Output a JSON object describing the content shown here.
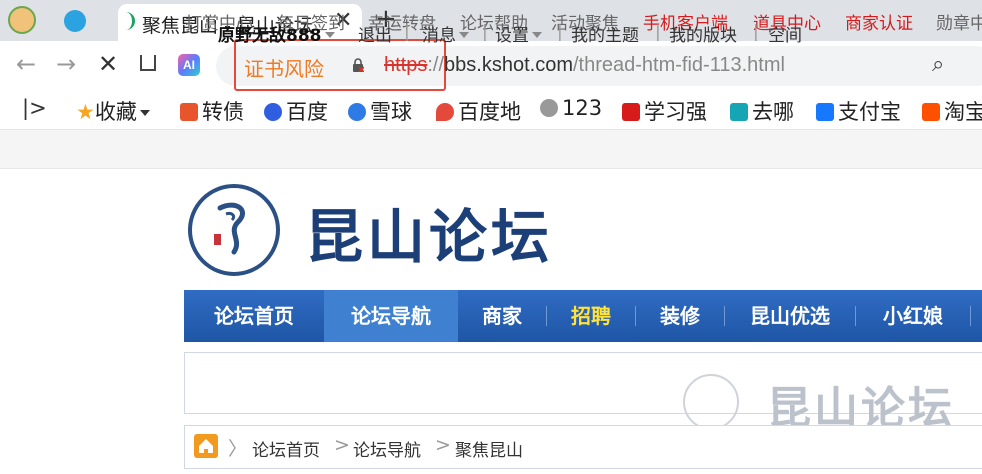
{
  "browser": {
    "tab_title": "聚焦昆山 - 昆山论坛",
    "tab_close": "✕",
    "new_tab": "+",
    "cert_warning": "证书风险",
    "url_scheme": "https",
    "url_sep": "://",
    "url_host": "bbs.kshot.com",
    "url_path": "/thread-htm-fid-113.html",
    "ai_label": "AI",
    "bookmarks": [
      {
        "label": "收藏",
        "icon": "star-icon",
        "color": "#f5a623"
      },
      {
        "label": "转债",
        "icon": "zhuanzhai-icon",
        "color": "#e8552c"
      },
      {
        "label": "百度",
        "icon": "baidu-paw-icon",
        "color": "#2f5fe0"
      },
      {
        "label": "雪球",
        "icon": "xueqiu-icon",
        "color": "#2f7be5"
      },
      {
        "label": "百度地",
        "icon": "map-pin-icon",
        "color": "#e34a3c"
      },
      {
        "label": "123",
        "icon": "globe-icon",
        "color": "#777777"
      },
      {
        "label": "学习强",
        "icon": "xuexi-icon",
        "color": "#d71b1b"
      },
      {
        "label": "去哪",
        "icon": "qunar-icon",
        "color": "#16a5b5"
      },
      {
        "label": "支付宝",
        "icon": "alipay-icon",
        "color": "#1677ff"
      },
      {
        "label": "淘宝",
        "icon": "taobao-icon",
        "color": "#ff5000"
      }
    ]
  },
  "site": {
    "top_links": [
      {
        "label": "打赏中心",
        "red": false
      },
      {
        "label": "每日签到",
        "red": false
      },
      {
        "label": "幸运转盘",
        "red": false
      },
      {
        "label": "论坛帮助",
        "red": false
      },
      {
        "label": "活动聚焦",
        "red": false
      },
      {
        "label": "手机客户端",
        "red": true
      },
      {
        "label": "道具中心",
        "red": true
      },
      {
        "label": "商家认证",
        "red": true
      },
      {
        "label": "勋章中",
        "red": false
      }
    ],
    "logo_text": "昆山论坛",
    "nav": [
      {
        "label": "论坛首页",
        "active": false,
        "yellow": false
      },
      {
        "label": "论坛导航",
        "active": true,
        "yellow": false
      },
      {
        "label": "商家",
        "active": false,
        "yellow": false
      },
      {
        "label": "招聘",
        "active": false,
        "yellow": true
      },
      {
        "label": "装修",
        "active": false,
        "yellow": false
      },
      {
        "label": "昆山优选",
        "active": false,
        "yellow": false
      },
      {
        "label": "小红娘",
        "active": false,
        "yellow": false
      }
    ],
    "user": {
      "username": "原野无敌888",
      "logout": "退出",
      "messages": "消息",
      "settings": "设置",
      "my_topics": "我的主题",
      "my_sections": "我的版块",
      "space": "空间"
    },
    "breadcrumb": [
      "论坛首页",
      "论坛导航",
      "聚焦昆山"
    ],
    "accent_color": "#1f56a6"
  }
}
